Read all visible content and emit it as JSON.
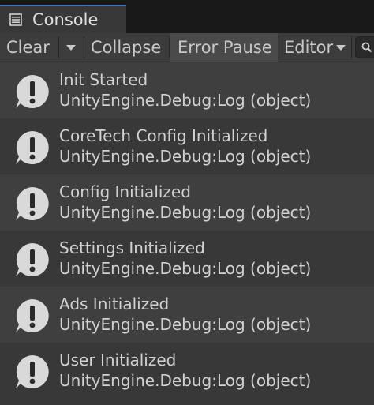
{
  "window": {
    "tab_title": "Console",
    "tab_icon": "console-list-icon"
  },
  "toolbar": {
    "clear_label": "Clear",
    "clear_dropdown_icon": "chevron-down-icon",
    "collapse_label": "Collapse",
    "error_pause_label": "Error Pause",
    "editor_label": "Editor",
    "editor_dropdown_icon": "chevron-down-icon",
    "search_icon": "search-icon",
    "error_pause_active": true
  },
  "log": {
    "entry_icon": "info-icon",
    "entries": [
      {
        "message": "Init Started",
        "source": "UnityEngine.Debug:Log (object)"
      },
      {
        "message": "CoreTech Config Initialized",
        "source": "UnityEngine.Debug:Log (object)"
      },
      {
        "message": "Config Initialized",
        "source": "UnityEngine.Debug:Log (object)"
      },
      {
        "message": "Settings Initialized",
        "source": "UnityEngine.Debug:Log (object)"
      },
      {
        "message": "Ads Initialized",
        "source": "UnityEngine.Debug:Log (object)"
      },
      {
        "message": "User Initialized",
        "source": "UnityEngine.Debug:Log (object)"
      }
    ]
  },
  "colors": {
    "tab_accent": "#3a79bb",
    "background": "#383838",
    "row_alt": "#3f3f3f",
    "text": "#d2d2d2",
    "icon_bubble": "#d9d9d9"
  }
}
